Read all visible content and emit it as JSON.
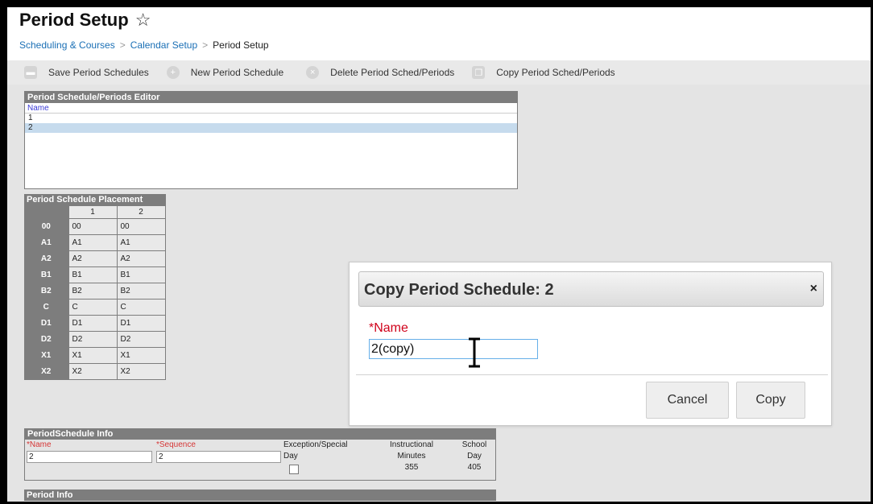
{
  "header": {
    "title": "Period Setup",
    "breadcrumb": [
      "Scheduling & Courses",
      "Calendar Setup",
      "Period Setup"
    ]
  },
  "toolbar": {
    "save_label": "Save Period Schedules",
    "new_label": "New Period Schedule",
    "delete_label": "Delete Period Sched/Periods",
    "copy_label": "Copy Period Sched/Periods"
  },
  "editor": {
    "title": "Period Schedule/Periods Editor",
    "column": "Name",
    "rows": [
      "1",
      "2"
    ],
    "selected_row": "2"
  },
  "placement": {
    "title": "Period Schedule Placement",
    "columns": [
      "1",
      "2"
    ],
    "rows": [
      {
        "period": "00",
        "values": [
          "00",
          "00"
        ]
      },
      {
        "period": "A1",
        "values": [
          "A1",
          "A1"
        ]
      },
      {
        "period": "A2",
        "values": [
          "A2",
          "A2"
        ]
      },
      {
        "period": "B1",
        "values": [
          "B1",
          "B1"
        ]
      },
      {
        "period": "B2",
        "values": [
          "B2",
          "B2"
        ]
      },
      {
        "period": "C",
        "values": [
          "C",
          "C"
        ]
      },
      {
        "period": "D1",
        "values": [
          "D1",
          "D1"
        ]
      },
      {
        "period": "D2",
        "values": [
          "D2",
          "D2"
        ]
      },
      {
        "period": "X1",
        "values": [
          "X1",
          "X1"
        ]
      },
      {
        "period": "X2",
        "values": [
          "X2",
          "X2"
        ]
      }
    ]
  },
  "info": {
    "title": "PeriodSchedule Info",
    "name_label": "*Name",
    "name_value": "2",
    "sequence_label": "*Sequence",
    "sequence_value": "2",
    "exception_label_1": "Exception/Special",
    "exception_label_2": "Day",
    "instr_label_1": "Instructional",
    "instr_label_2": "Minutes",
    "instr_value": "355",
    "school_label_1": "School",
    "school_label_2": "Day",
    "school_value": "405"
  },
  "period_info": {
    "title": "Period Info"
  },
  "dialog": {
    "title": "Copy Period Schedule: 2",
    "close": "×",
    "name_label": "*Name",
    "name_value": "2(copy)",
    "cancel_label": "Cancel",
    "copy_label": "Copy"
  },
  "colors": {
    "panel_gray": "#7d7d7d",
    "link_blue": "#1a6fb5",
    "required_red": "#d0021b",
    "selected_row": "#c6dbed"
  }
}
